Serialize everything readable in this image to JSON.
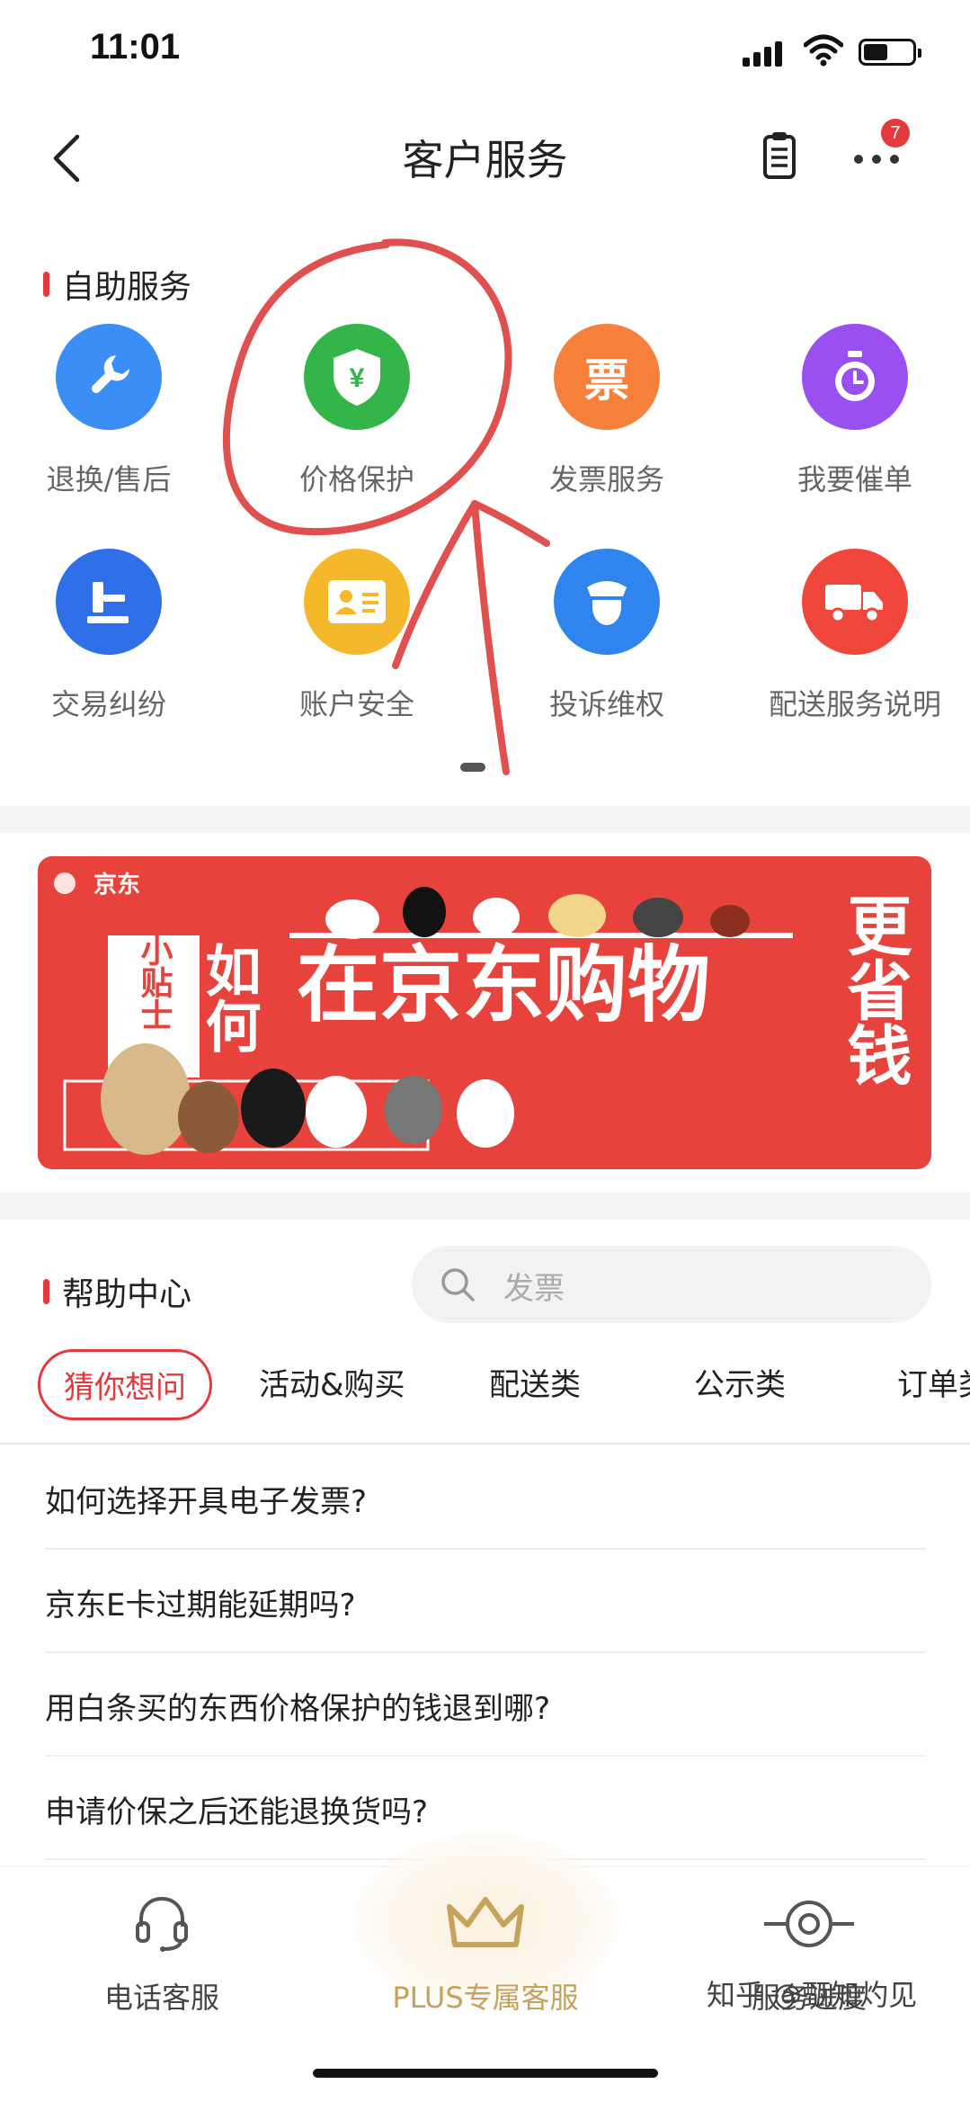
{
  "status_bar": {
    "time": "11:01"
  },
  "header": {
    "title": "客户服务",
    "notification_count": "7"
  },
  "self_service": {
    "title": "自助服务",
    "items": [
      {
        "label": "退换/售后",
        "icon": "wrench-icon",
        "color": "#3a8ef6"
      },
      {
        "label": "价格保护",
        "icon": "shield-yen-icon",
        "color": "#33b54a"
      },
      {
        "label": "发票服务",
        "icon": "invoice-ticket-icon",
        "color": "#f7813a",
        "glyph": "票"
      },
      {
        "label": "我要催单",
        "icon": "timer-icon",
        "color": "#9a4ff0"
      },
      {
        "label": "交易纠纷",
        "icon": "gavel-icon",
        "color": "#2f6fe8"
      },
      {
        "label": "账户安全",
        "icon": "id-card-icon",
        "color": "#f5b82a"
      },
      {
        "label": "投诉维权",
        "icon": "police-officer-icon",
        "color": "#2f84ee"
      },
      {
        "label": "配送服务说明",
        "icon": "delivery-truck-icon",
        "color": "#f0463b"
      }
    ]
  },
  "banner": {
    "brand": "京东",
    "tag": "小贴士",
    "headline_left": "如何",
    "headline_main": "在京东购物",
    "headline_right": "更省钱"
  },
  "help_center": {
    "title": "帮助中心",
    "search_placeholder": "发票",
    "tabs": [
      "猜你想问",
      "活动&购买",
      "配送类",
      "公示类",
      "订单类"
    ],
    "questions": [
      "如何选择开具电子发票?",
      "京东E卡过期能延期吗?",
      "用白条买的东西价格保护的钱退到哪?",
      "申请价保之后还能退换货吗?"
    ]
  },
  "bottom_bar": {
    "phone_service": "电话客服",
    "plus_service": "PLUS专属客服",
    "service_progress": "服务进度"
  },
  "watermark": "知乎 @甄知灼见",
  "colors": {
    "accent": "#e4393c",
    "plus_gold": "#c7a25a",
    "annotation_red": "#e0504f"
  }
}
